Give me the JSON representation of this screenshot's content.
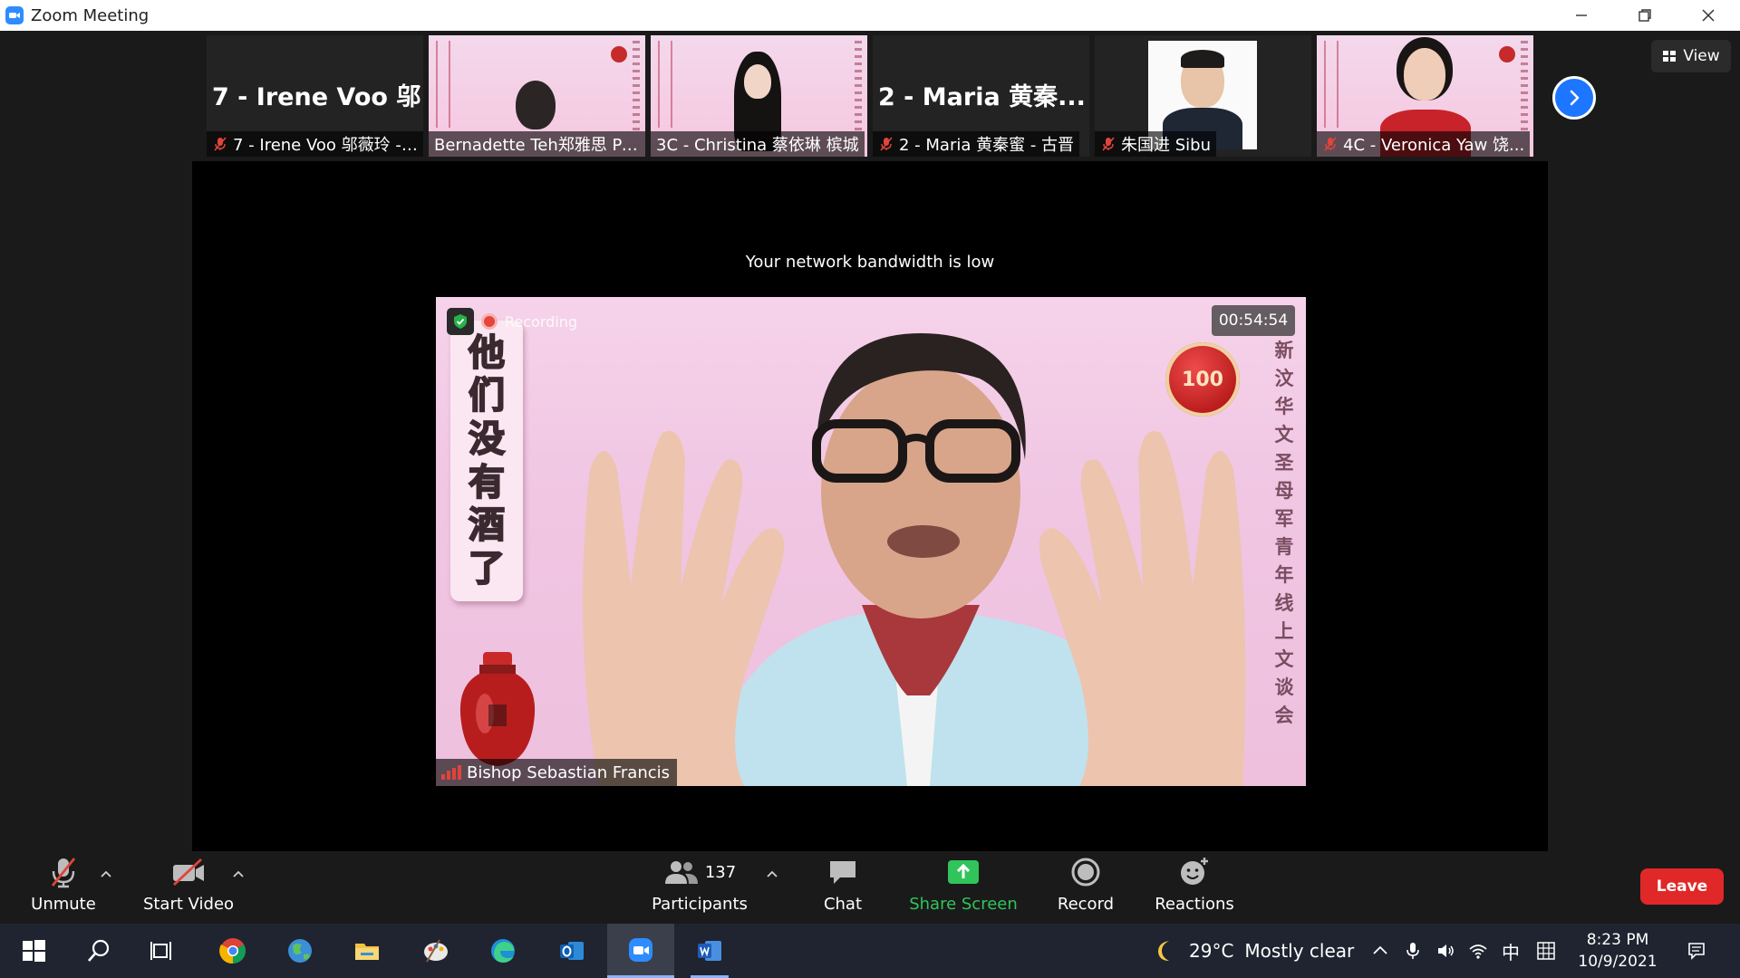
{
  "window": {
    "title": "Zoom Meeting"
  },
  "thumbnails": [
    {
      "big_name": "7 - Irene Voo 邬...",
      "name": "7 - Irene Voo 邬薇玲 - ...",
      "muted": true,
      "video": false
    },
    {
      "name": "Bernadette Teh郑雅思 Pe...",
      "muted": false,
      "video": true
    },
    {
      "name": "3C - Christina 蔡依琳 槟城",
      "muted": false,
      "video": true
    },
    {
      "big_name": "2 - Maria 黄秦...",
      "name": "2 - Maria 黄秦蜜 - 古晋",
      "muted": true,
      "video": false
    },
    {
      "name": "朱国进 Sibu",
      "muted": true,
      "video": true
    },
    {
      "name": "4C - Veronica Yaw 饶...",
      "muted": true,
      "video": true
    }
  ],
  "view_button": {
    "label": "View"
  },
  "network_notice": "Your network bandwidth is low",
  "speaker": {
    "name": "Bishop Sebastian Francis",
    "timer": "00:54:54",
    "recording_label": "Recording",
    "scroll_chars": [
      "他",
      "们",
      "没",
      "有",
      "酒",
      "了"
    ],
    "vertical_text": [
      "新",
      "汶",
      "华",
      "文",
      "圣",
      "母",
      "军",
      "青",
      "年",
      "线",
      "上",
      "文",
      "谈",
      "会"
    ],
    "logo_text": "100"
  },
  "toolbar": {
    "unmute": "Unmute",
    "start_video": "Start Video",
    "participants": "Participants",
    "participant_count": "137",
    "chat": "Chat",
    "share_screen": "Share Screen",
    "record": "Record",
    "reactions": "Reactions",
    "leave": "Leave"
  },
  "taskbar": {
    "weather_temp": "29°C",
    "weather_desc": "Mostly clear",
    "ime": "中",
    "time": "8:23 PM",
    "date": "10/9/2021"
  },
  "colors": {
    "zoom_blue": "#2d8cff",
    "share_green": "#31c45b",
    "leave_red": "#e02828",
    "muted_red": "#e0443a"
  }
}
